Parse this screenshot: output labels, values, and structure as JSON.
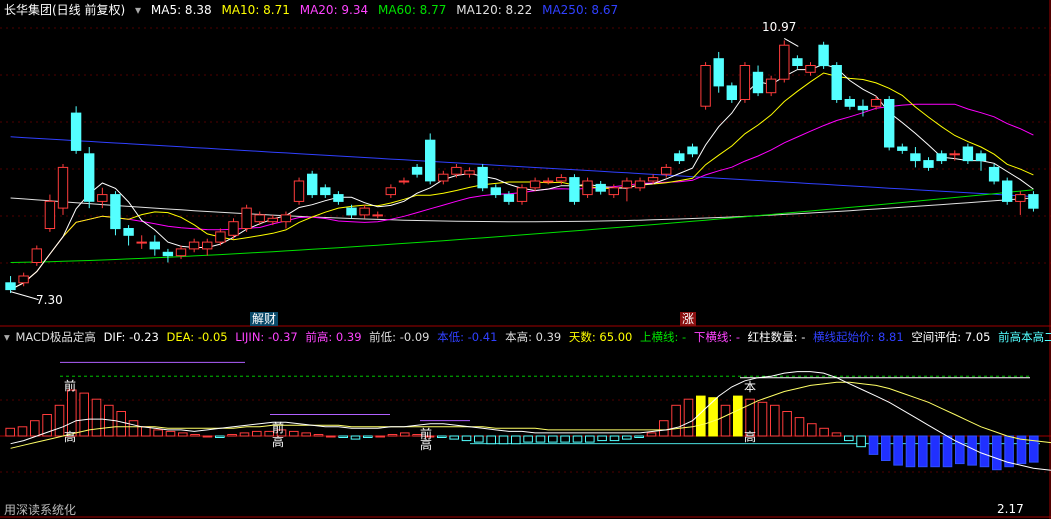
{
  "colors": {
    "up": "#ff3c3c",
    "down": "#54ffff",
    "ma5": "#ffffff",
    "ma10": "#ffff00",
    "ma20": "#ff00ff",
    "ma60": "#00e000",
    "ma120": "#e0e0e0",
    "ma250": "#3040ff",
    "grid": "#a00000",
    "dif": "#ffffff",
    "dea": "#ffff66"
  },
  "header_top": {
    "title": "长华集团(日线 前复权)",
    "ma5": "MA5: 8.38",
    "ma10": "MA10: 8.71",
    "ma20": "MA20: 9.34",
    "ma60": "MA60: 8.77",
    "ma120": "MA120: 8.22",
    "ma250": "MA250: 8.67"
  },
  "header_bottom": {
    "name": "MACD极品定高",
    "dif": "DIF: -0.23",
    "dea": "DEA: -0.05",
    "lijin": "LIJIN: -0.37",
    "qiangao": "前高: 0.39",
    "qiandi": "前低: -0.09",
    "bendi": "本低: -0.41",
    "bengao": "本高: 0.39",
    "tianshu": "天数: 65.00",
    "shanghengxian": "上横线: -",
    "xiahengxian": "下横线: -",
    "hongzhu": "红柱数量: -",
    "hengxianqidian": "横线起始价: 8.81",
    "kongjian": "空间评估: 7.05",
    "erfen": "前高本高二分位: -"
  },
  "labels": {
    "high_price": "10.97",
    "low_price": "7.30",
    "event_jiecai": "解财",
    "event_zhang": "涨",
    "macd_qian1": "前",
    "macd_gao1": "高",
    "macd_qian2": "前",
    "macd_gao2": "高",
    "macd_qian3": "前",
    "macd_gao3": "高",
    "macd_ben": "本",
    "macd_gao4": "高",
    "macd_low": "2.17",
    "watermark": "用深读系统化"
  },
  "chart_data": {
    "type": "candlestick",
    "price": {
      "ylim": [
        7.0,
        11.3
      ],
      "candles": [
        [
          7.4,
          7.3,
          7.5,
          7.25
        ],
        [
          7.4,
          7.5,
          7.55,
          7.35
        ],
        [
          7.7,
          7.9,
          7.95,
          7.65
        ],
        [
          8.2,
          8.6,
          8.7,
          8.15
        ],
        [
          8.5,
          9.1,
          9.15,
          8.4
        ],
        [
          9.9,
          9.35,
          10.0,
          9.3
        ],
        [
          9.3,
          8.6,
          9.4,
          8.5
        ],
        [
          8.6,
          8.7,
          8.8,
          8.5
        ],
        [
          8.7,
          8.2,
          8.75,
          8.1
        ],
        [
          8.2,
          8.1,
          8.25,
          7.95
        ],
        [
          8.0,
          8.0,
          8.1,
          7.9
        ],
        [
          8.0,
          7.9,
          8.1,
          7.8
        ],
        [
          7.85,
          7.8,
          7.9,
          7.7
        ],
        [
          7.8,
          7.9,
          7.95,
          7.75
        ],
        [
          7.9,
          8.0,
          8.05,
          7.85
        ],
        [
          7.9,
          8.0,
          8.05,
          7.8
        ],
        [
          8.0,
          8.15,
          8.2,
          7.95
        ],
        [
          8.1,
          8.3,
          8.35,
          8.05
        ],
        [
          8.2,
          8.5,
          8.55,
          8.15
        ],
        [
          8.3,
          8.4,
          8.45,
          8.25
        ],
        [
          8.3,
          8.35,
          8.4,
          8.25
        ],
        [
          8.3,
          8.4,
          8.45,
          8.2
        ],
        [
          8.6,
          8.9,
          8.95,
          8.55
        ],
        [
          9.0,
          8.7,
          9.05,
          8.65
        ],
        [
          8.8,
          8.7,
          8.85,
          8.65
        ],
        [
          8.7,
          8.6,
          8.75,
          8.55
        ],
        [
          8.5,
          8.4,
          8.55,
          8.35
        ],
        [
          8.4,
          8.5,
          8.55,
          8.35
        ],
        [
          8.4,
          8.4,
          8.45,
          8.35
        ],
        [
          8.7,
          8.8,
          8.85,
          8.65
        ],
        [
          8.9,
          8.9,
          8.95,
          8.85
        ],
        [
          9.1,
          9.0,
          9.15,
          8.95
        ],
        [
          9.5,
          8.9,
          9.6,
          8.85
        ],
        [
          8.9,
          9.0,
          9.05,
          8.85
        ],
        [
          9.0,
          9.1,
          9.15,
          8.95
        ],
        [
          9.0,
          9.05,
          9.1,
          8.95
        ],
        [
          9.1,
          8.8,
          9.15,
          8.75
        ],
        [
          8.8,
          8.7,
          8.85,
          8.65
        ],
        [
          8.7,
          8.6,
          8.75,
          8.55
        ],
        [
          8.6,
          8.8,
          8.85,
          8.55
        ],
        [
          8.8,
          8.9,
          8.95,
          8.75
        ],
        [
          8.9,
          8.9,
          8.95,
          8.85
        ],
        [
          8.9,
          8.95,
          9.0,
          8.85
        ],
        [
          8.95,
          8.6,
          9.0,
          8.55
        ],
        [
          8.7,
          8.9,
          8.95,
          8.65
        ],
        [
          8.85,
          8.75,
          8.9,
          8.7
        ],
        [
          8.7,
          8.8,
          8.85,
          8.65
        ],
        [
          8.8,
          8.9,
          8.95,
          8.6
        ],
        [
          8.8,
          8.9,
          8.95,
          8.75
        ],
        [
          8.9,
          8.95,
          9.0,
          8.85
        ],
        [
          9.0,
          9.1,
          9.15,
          8.95
        ],
        [
          9.3,
          9.2,
          9.35,
          9.15
        ],
        [
          9.4,
          9.3,
          9.45,
          9.25
        ],
        [
          10.0,
          10.6,
          10.65,
          9.95
        ],
        [
          10.7,
          10.3,
          10.8,
          10.2
        ],
        [
          10.3,
          10.1,
          10.35,
          10.05
        ],
        [
          10.1,
          10.6,
          10.65,
          10.05
        ],
        [
          10.5,
          10.2,
          10.6,
          10.15
        ],
        [
          10.2,
          10.4,
          10.45,
          10.15
        ],
        [
          10.4,
          10.9,
          10.97,
          10.35
        ],
        [
          10.7,
          10.6,
          10.75,
          10.55
        ],
        [
          10.5,
          10.6,
          10.65,
          10.45
        ],
        [
          10.9,
          10.6,
          10.95,
          10.55
        ],
        [
          10.6,
          10.1,
          10.65,
          10.05
        ],
        [
          10.1,
          10.0,
          10.15,
          9.95
        ],
        [
          10.0,
          9.95,
          10.1,
          9.85
        ],
        [
          10.0,
          10.1,
          10.15,
          9.95
        ],
        [
          10.1,
          9.4,
          10.15,
          9.35
        ],
        [
          9.4,
          9.35,
          9.45,
          9.3
        ],
        [
          9.3,
          9.2,
          9.4,
          9.1
        ],
        [
          9.2,
          9.1,
          9.25,
          9.05
        ],
        [
          9.3,
          9.2,
          9.35,
          9.15
        ],
        [
          9.3,
          9.3,
          9.35,
          9.2
        ],
        [
          9.4,
          9.2,
          9.45,
          9.15
        ],
        [
          9.3,
          9.2,
          9.35,
          9.05
        ],
        [
          9.1,
          8.9,
          9.15,
          8.85
        ],
        [
          8.9,
          8.6,
          8.95,
          8.55
        ],
        [
          8.6,
          8.7,
          8.75,
          8.4
        ],
        [
          8.7,
          8.5,
          8.75,
          8.45
        ]
      ],
      "annotations": [
        {
          "label": "high",
          "x": 59,
          "value": 10.97
        },
        {
          "label": "low",
          "x": 0,
          "value": 7.3
        }
      ]
    },
    "macd": {
      "ylim": [
        -0.45,
        0.6
      ],
      "bars": [
        0.05,
        0.06,
        0.1,
        0.14,
        0.2,
        0.3,
        0.28,
        0.24,
        0.2,
        0.16,
        0.1,
        0.06,
        0.04,
        0.03,
        0.02,
        0.01,
        0.0,
        -0.01,
        0.01,
        0.02,
        0.03,
        0.03,
        0.04,
        0.03,
        0.02,
        0.01,
        0.0,
        -0.01,
        -0.02,
        -0.01,
        0.0,
        0.01,
        0.02,
        0.01,
        0.0,
        -0.01,
        -0.02,
        -0.03,
        -0.04,
        -0.05,
        -0.05,
        -0.05,
        -0.04,
        -0.04,
        -0.04,
        -0.04,
        -0.04,
        -0.04,
        -0.03,
        -0.03,
        -0.02,
        -0.01,
        0.02,
        0.1,
        0.2,
        0.24,
        0.26,
        0.25,
        0.2,
        0.26,
        0.24,
        0.22,
        0.2,
        0.16,
        0.12,
        0.08,
        0.05,
        0.02,
        -0.03,
        -0.07,
        -0.12,
        -0.16,
        -0.19,
        -0.2,
        -0.2,
        -0.2,
        -0.2,
        -0.18,
        -0.19,
        -0.2,
        -0.22,
        -0.2,
        -0.18,
        -0.17
      ],
      "dif": [
        -0.05,
        -0.03,
        0.0,
        0.03,
        0.06,
        0.1,
        0.11,
        0.11,
        0.1,
        0.08,
        0.06,
        0.05,
        0.04,
        0.04,
        0.03,
        0.04,
        0.05,
        0.06,
        0.07,
        0.08,
        0.09,
        0.09,
        0.08,
        0.07,
        0.06,
        0.06,
        0.05,
        0.05,
        0.05,
        0.06,
        0.06,
        0.07,
        0.08,
        0.08,
        0.07,
        0.06,
        0.05,
        0.04,
        0.03,
        0.03,
        0.02,
        0.02,
        0.02,
        0.02,
        0.02,
        0.02,
        0.02,
        0.02,
        0.02,
        0.03,
        0.04,
        0.06,
        0.1,
        0.18,
        0.26,
        0.32,
        0.36,
        0.38,
        0.39,
        0.41,
        0.42,
        0.42,
        0.41,
        0.38,
        0.34,
        0.3,
        0.26,
        0.22,
        0.17,
        0.12,
        0.07,
        0.02,
        -0.03,
        -0.07,
        -0.11,
        -0.14,
        -0.17,
        -0.19,
        -0.21,
        -0.22,
        -0.23,
        -0.23,
        -0.23,
        -0.23
      ],
      "dea": [
        -0.08,
        -0.06,
        -0.04,
        -0.02,
        0.0,
        0.02,
        0.04,
        0.05,
        0.06,
        0.06,
        0.06,
        0.06,
        0.05,
        0.05,
        0.05,
        0.05,
        0.05,
        0.05,
        0.06,
        0.06,
        0.07,
        0.07,
        0.07,
        0.07,
        0.07,
        0.07,
        0.06,
        0.06,
        0.06,
        0.06,
        0.06,
        0.06,
        0.06,
        0.06,
        0.06,
        0.06,
        0.06,
        0.05,
        0.05,
        0.05,
        0.05,
        0.04,
        0.04,
        0.04,
        0.04,
        0.04,
        0.04,
        0.04,
        0.04,
        0.04,
        0.04,
        0.05,
        0.06,
        0.08,
        0.11,
        0.15,
        0.19,
        0.23,
        0.26,
        0.29,
        0.31,
        0.33,
        0.34,
        0.35,
        0.35,
        0.34,
        0.33,
        0.31,
        0.28,
        0.25,
        0.22,
        0.18,
        0.14,
        0.1,
        0.06,
        0.03,
        0.0,
        -0.02,
        -0.03,
        -0.04,
        -0.05,
        -0.05,
        -0.05,
        -0.05
      ],
      "ref_lines": {
        "qiangao": 0.39,
        "zero": 0,
        "bendi": -0.41
      }
    }
  }
}
